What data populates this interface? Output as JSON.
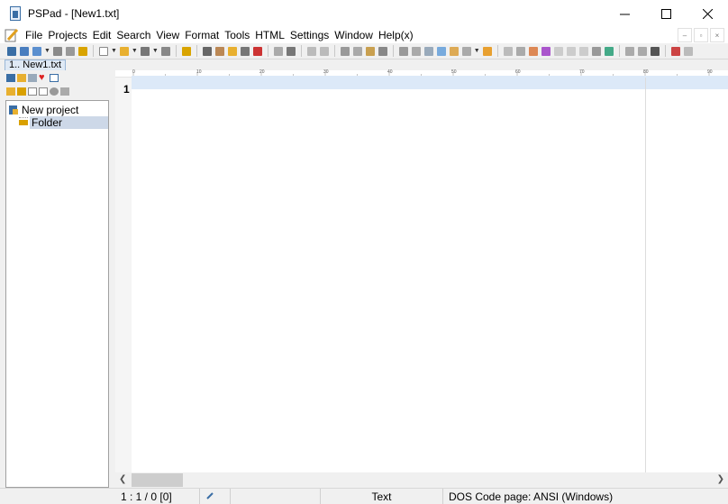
{
  "window": {
    "title": "PSPad - [New1.txt]",
    "controls": {
      "minimize": "minimize",
      "maximize": "maximize",
      "close": "close"
    }
  },
  "menu": {
    "items": [
      "File",
      "Projects",
      "Edit",
      "Search",
      "View",
      "Format",
      "Tools",
      "HTML",
      "Settings",
      "Window",
      "Help(x)"
    ]
  },
  "tabs": [
    {
      "label": "1.. New1.txt"
    }
  ],
  "ruler": {
    "marks": [
      "0",
      "10",
      "20",
      "30",
      "40",
      "50",
      "60",
      "70",
      "80",
      "90"
    ]
  },
  "project_tree": {
    "root": "New project",
    "children": [
      "Folder"
    ]
  },
  "editor": {
    "line_numbers": [
      "1"
    ],
    "content": ""
  },
  "statusbar": {
    "position": "1 : 1 / 0  [0]",
    "syntax": "Text",
    "code_page": "DOS Code page: ANSI (Windows)"
  },
  "colors": {
    "current_line": "#dce9f8",
    "tree_selection": "#cdd8e8",
    "tab_active": "#dfe9f5"
  }
}
